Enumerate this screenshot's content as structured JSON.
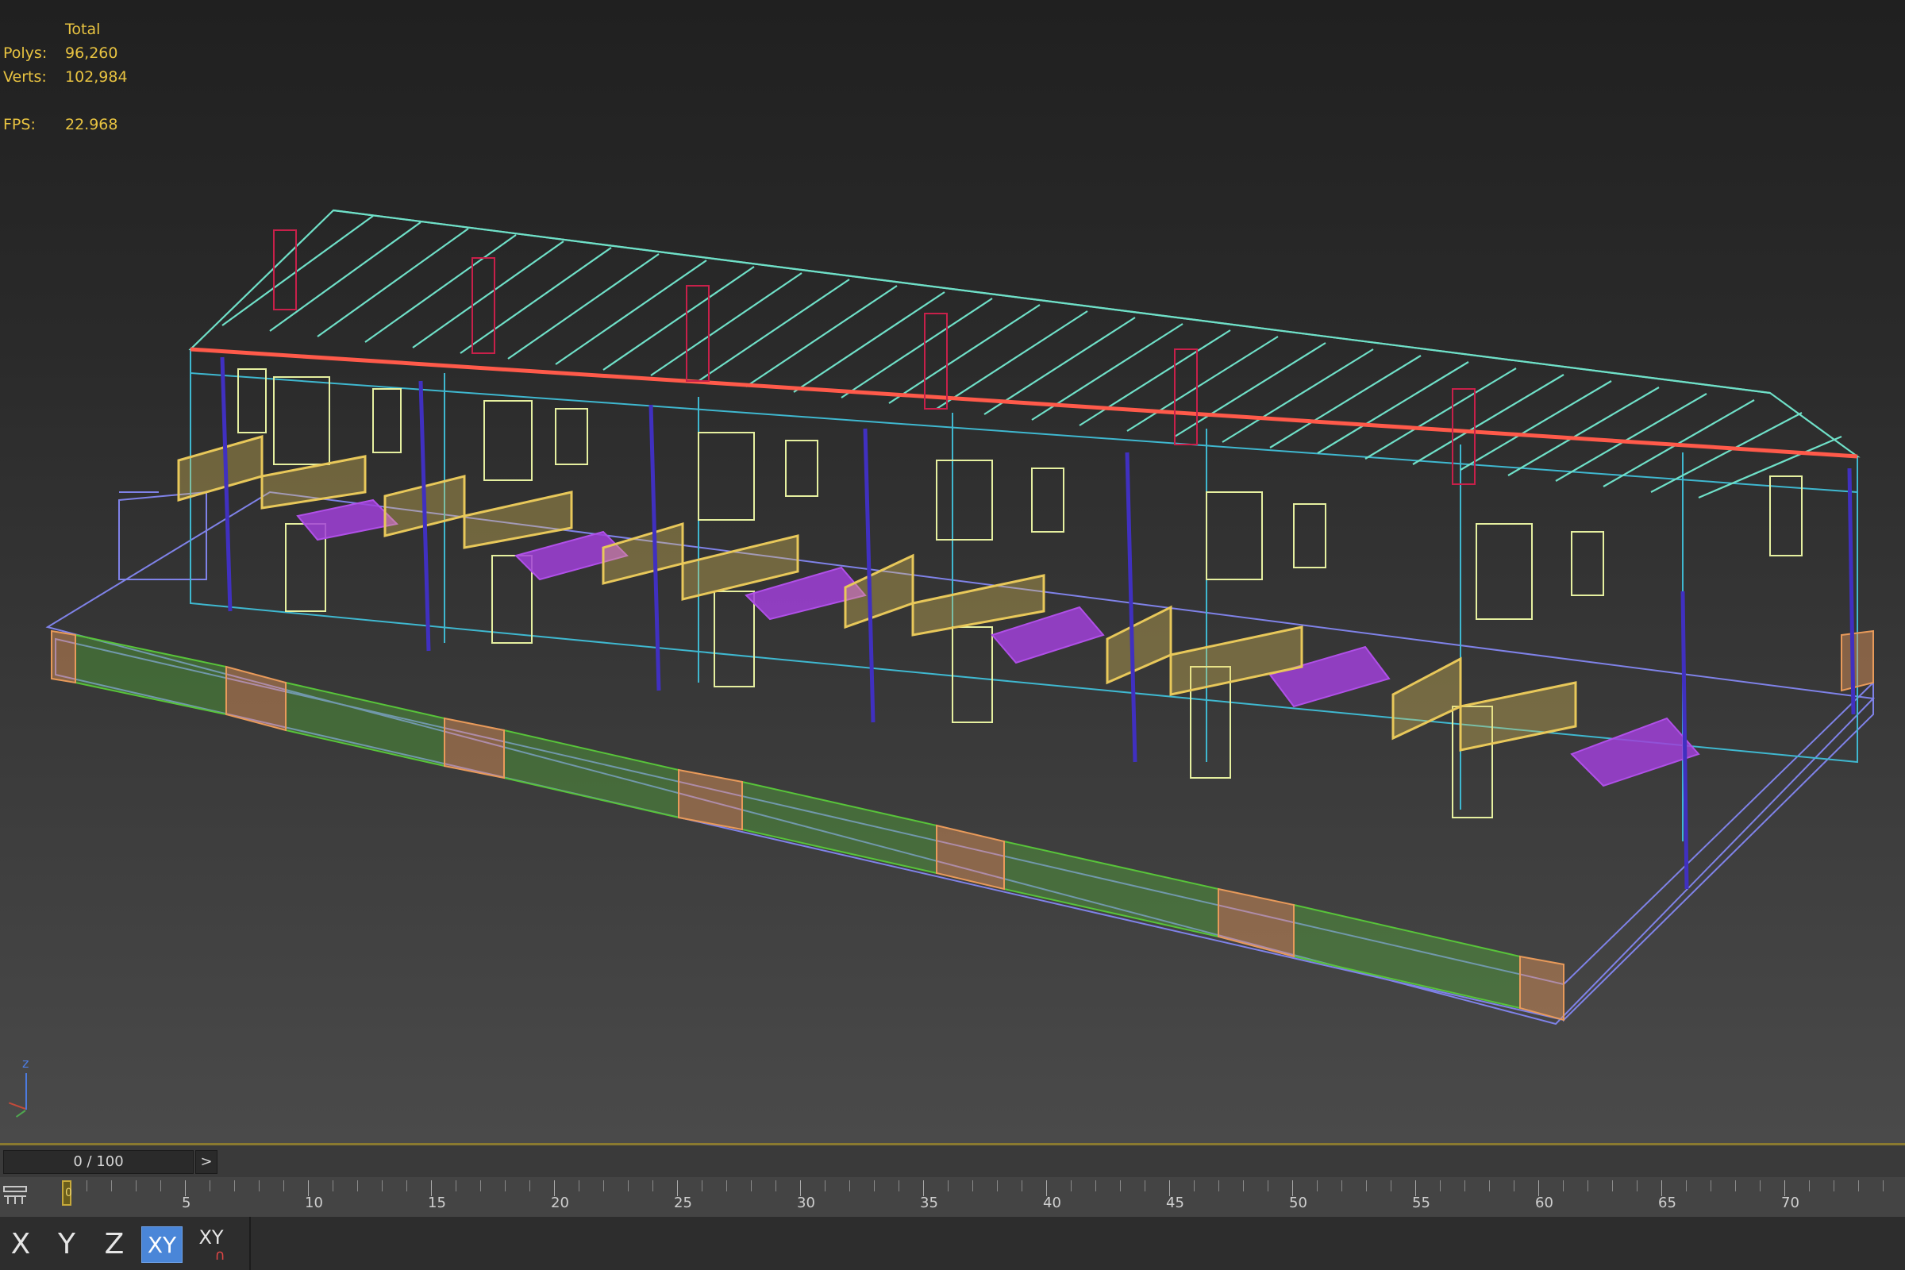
{
  "stats": {
    "header": "Total",
    "polys_label": "Polys:",
    "polys_value": "96,260",
    "verts_label": "Verts:",
    "verts_value": "102,984",
    "fps_label": "FPS:",
    "fps_value": "22.968"
  },
  "axis_tripod": {
    "label": "z"
  },
  "timeline": {
    "frame_display": "0 / 100",
    "next_label": ">",
    "current_frame_label": "0",
    "ruler_labels": [
      "5",
      "10",
      "15",
      "20",
      "25",
      "30",
      "35",
      "40",
      "45",
      "50",
      "55",
      "60",
      "65",
      "70"
    ]
  },
  "axis_constraints": {
    "x": "X",
    "y": "Y",
    "z": "Z",
    "xy": "XY",
    "xy_snap": "XY",
    "active": "XY"
  },
  "colors": {
    "roof": "#6fe0c8",
    "walls": "#3fb8d0",
    "windows": "#e6f0a0",
    "balcony_rail": "#e8c85a",
    "balcony_floor": "#a040d8",
    "fence_green": "#58c43a",
    "fence_orange": "#e89a5a",
    "chimney": "#c8204a",
    "eave": "#ff5a4a",
    "ground": "#8080e0"
  }
}
